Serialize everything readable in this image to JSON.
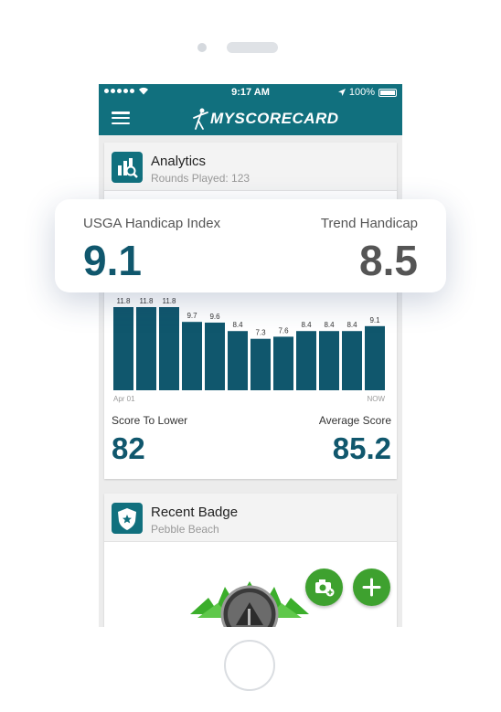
{
  "status": {
    "time": "9:17 AM",
    "battery": "100%"
  },
  "app": {
    "logo_text": "MYSCORECARD"
  },
  "analytics": {
    "title": "Analytics",
    "subtitle": "Rounds Played: 123",
    "score_to_lower_label": "Score To Lower",
    "score_to_lower": "82",
    "average_score_label": "Average Score",
    "average_score": "85.2"
  },
  "popup": {
    "usga_label": "USGA Handicap Index",
    "usga_value": "9.1",
    "trend_label": "Trend Handicap",
    "trend_value": "8.5"
  },
  "badge": {
    "title": "Recent Badge",
    "subtitle": "Pebble Beach"
  },
  "chart_data": {
    "type": "bar",
    "categories": [
      "Apr 01",
      "",
      "",
      "",
      "",
      "",
      "",
      "",
      "",
      "",
      "",
      "NOW"
    ],
    "values": [
      11.8,
      11.8,
      11.8,
      9.7,
      9.6,
      8.4,
      7.3,
      7.6,
      8.4,
      8.4,
      8.4,
      9.1
    ],
    "labels": [
      "11.8",
      "11.8",
      "11.8",
      "9.7",
      "9.6",
      "8.4",
      "7.3",
      "7.6",
      "8.4",
      "8.4",
      "8.4",
      "9.1"
    ],
    "x_start_label": "Apr 01",
    "x_end_label": "NOW",
    "ylim": [
      0,
      12
    ],
    "grid": false,
    "colors": {
      "bar": "#10576d"
    }
  },
  "colors": {
    "brand": "#11707e",
    "accent_green": "#3ea12f",
    "value_text": "#10576d"
  }
}
